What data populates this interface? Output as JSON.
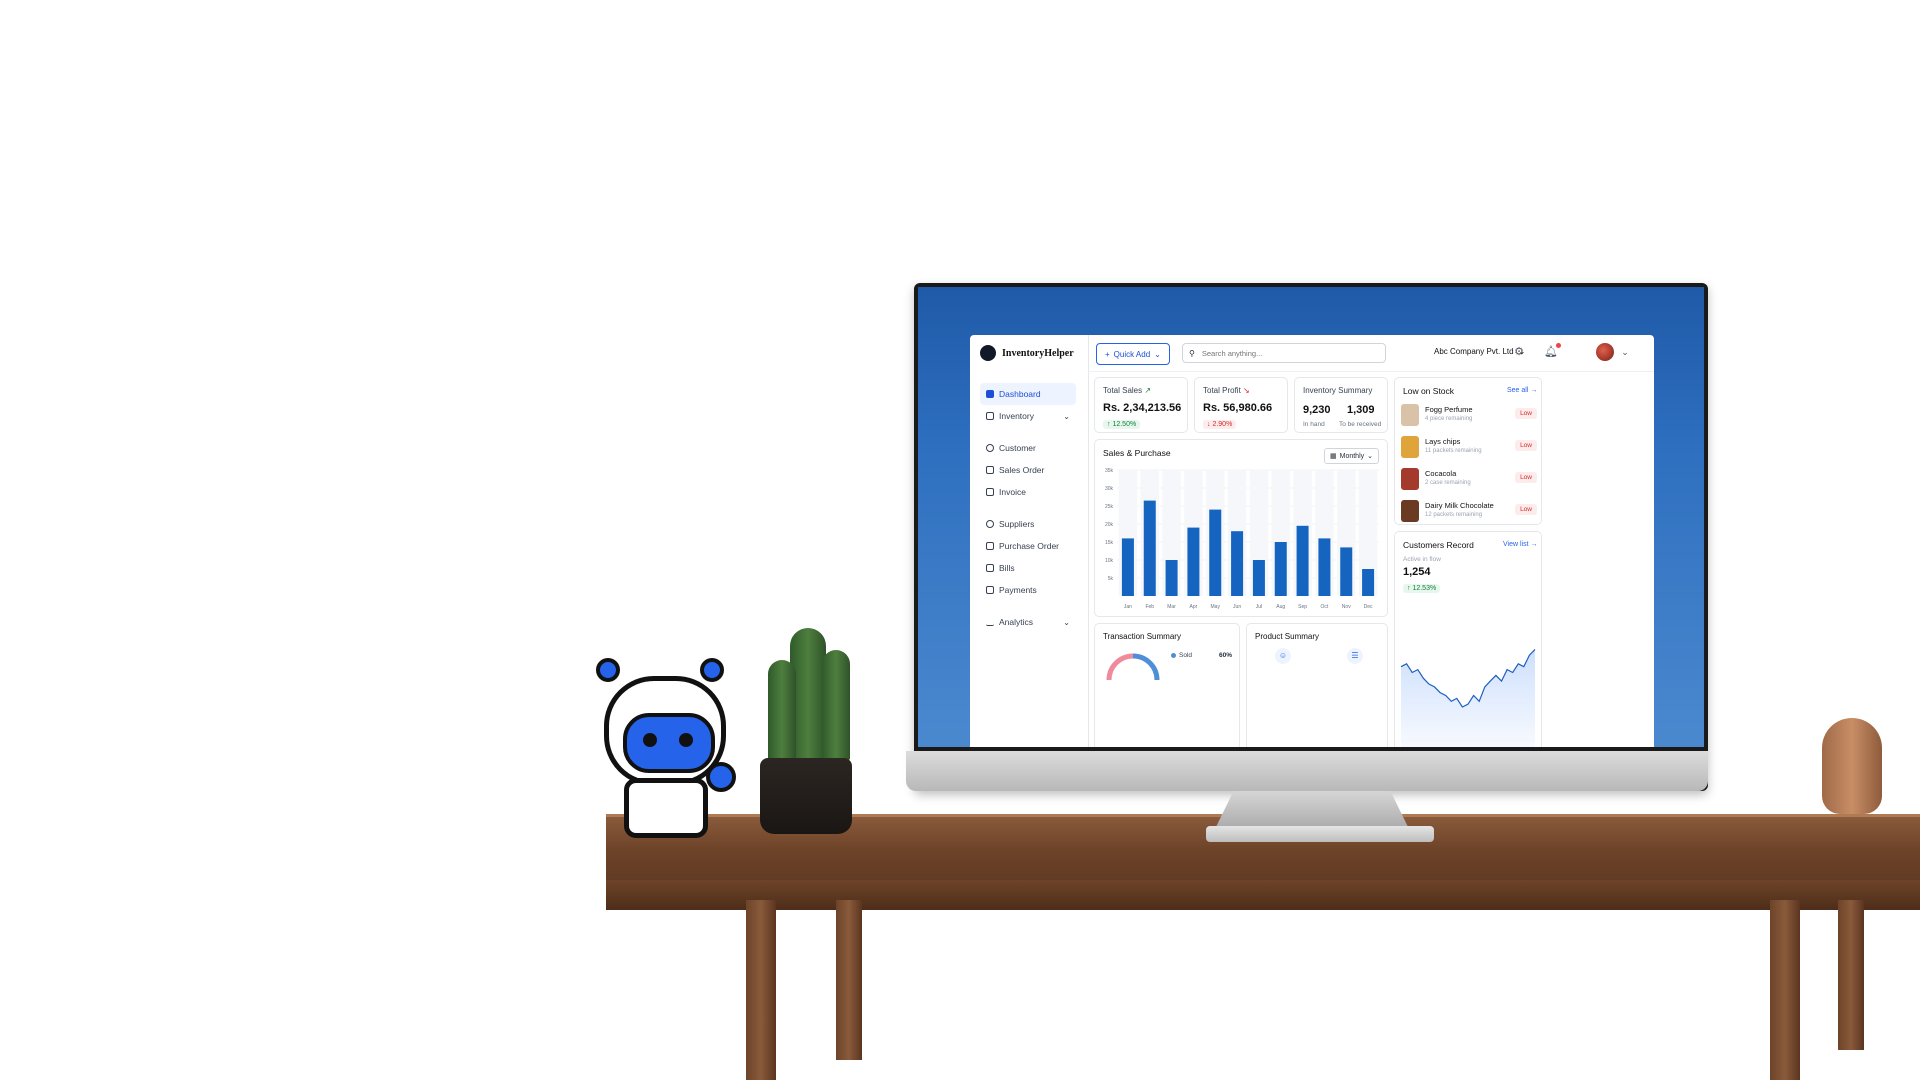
{
  "app": {
    "brand": "InventoryHelper",
    "nav": [
      {
        "label": "Dashboard",
        "active": true
      },
      {
        "label": "Inventory",
        "chevron": "⌄"
      },
      {
        "label": "Customer"
      },
      {
        "label": "Sales Order"
      },
      {
        "label": "Invoice"
      },
      {
        "label": "Suppliers"
      },
      {
        "label": "Purchase Order"
      },
      {
        "label": "Bills"
      },
      {
        "label": "Payments"
      },
      {
        "label": "Analytics",
        "chevron": "⌄"
      }
    ],
    "topbar": {
      "quick_add": "Quick Add",
      "search_placeholder": "Search anything...",
      "company": "Abc Company Pvt. Ltd"
    },
    "total_sales": {
      "title": "Total Sales",
      "value": "Rs. 2,34,213.56",
      "change": "↑ 12.50%"
    },
    "total_profit": {
      "title": "Total Profit",
      "value": "Rs. 56,980.66",
      "change": "↓ 2.90%"
    },
    "inventory_summary": {
      "title": "Inventory Summary",
      "in_hand": "9,230",
      "in_hand_label": "In hand",
      "to_receive": "1,309",
      "to_receive_label": "To be received"
    },
    "low_stock": {
      "title": "Low on Stock",
      "see_all": "See all",
      "items": [
        {
          "name": "Fogg Perfume",
          "sub": "4 piece remaining",
          "badge": "Low",
          "color": "#d9c2a7"
        },
        {
          "name": "Lays chips",
          "sub": "11 packets remaining",
          "badge": "Low",
          "color": "#e0a53a"
        },
        {
          "name": "Cocacola",
          "sub": "2 case remaining",
          "badge": "Low",
          "color": "#a33a2c"
        },
        {
          "name": "Dairy Milk Chocolate",
          "sub": "12 packets remaining",
          "badge": "Low",
          "color": "#6b3a22"
        }
      ]
    },
    "customers_record": {
      "title": "Customers Record",
      "view_list": "View list",
      "subtitle": "Active in flow",
      "value": "1,254",
      "change": "↑ 12.53%"
    },
    "transaction_summary": {
      "title": "Transaction Summary",
      "legend": "Sold",
      "percent": "60%"
    },
    "product_summary": {
      "title": "Product Summary"
    },
    "colors": {
      "primary": "#1565c0",
      "accent": "#2563eb",
      "danger": "#dc2626",
      "success": "#15803d"
    }
  },
  "chart_data": [
    {
      "type": "bar",
      "title": "Sales & Purchase",
      "period_selector": "Monthly",
      "categories": [
        "Jan",
        "Feb",
        "Mar",
        "Apr",
        "May",
        "Jun",
        "Jul",
        "Aug",
        "Sep",
        "Oct",
        "Nov",
        "Dec"
      ],
      "values": [
        16000,
        26500,
        10000,
        19000,
        24000,
        18000,
        10000,
        15000,
        19500,
        16000,
        13500,
        7500
      ],
      "ytick_labels": [
        "5k",
        "10k",
        "15k",
        "20k",
        "25k",
        "30k",
        "35k"
      ],
      "ylim": [
        0,
        35000
      ]
    },
    {
      "type": "area",
      "title": "Customers Record",
      "x": [
        0,
        1,
        2,
        3,
        4,
        5,
        6,
        7,
        8,
        9,
        10,
        11,
        12,
        13,
        14,
        15,
        16,
        17,
        18,
        19,
        20,
        21,
        22,
        23,
        24
      ],
      "values": [
        62,
        64,
        58,
        60,
        54,
        50,
        48,
        44,
        42,
        38,
        40,
        34,
        36,
        42,
        38,
        48,
        52,
        56,
        52,
        60,
        58,
        64,
        62,
        70,
        74
      ],
      "ylim": [
        0,
        100
      ]
    }
  ]
}
